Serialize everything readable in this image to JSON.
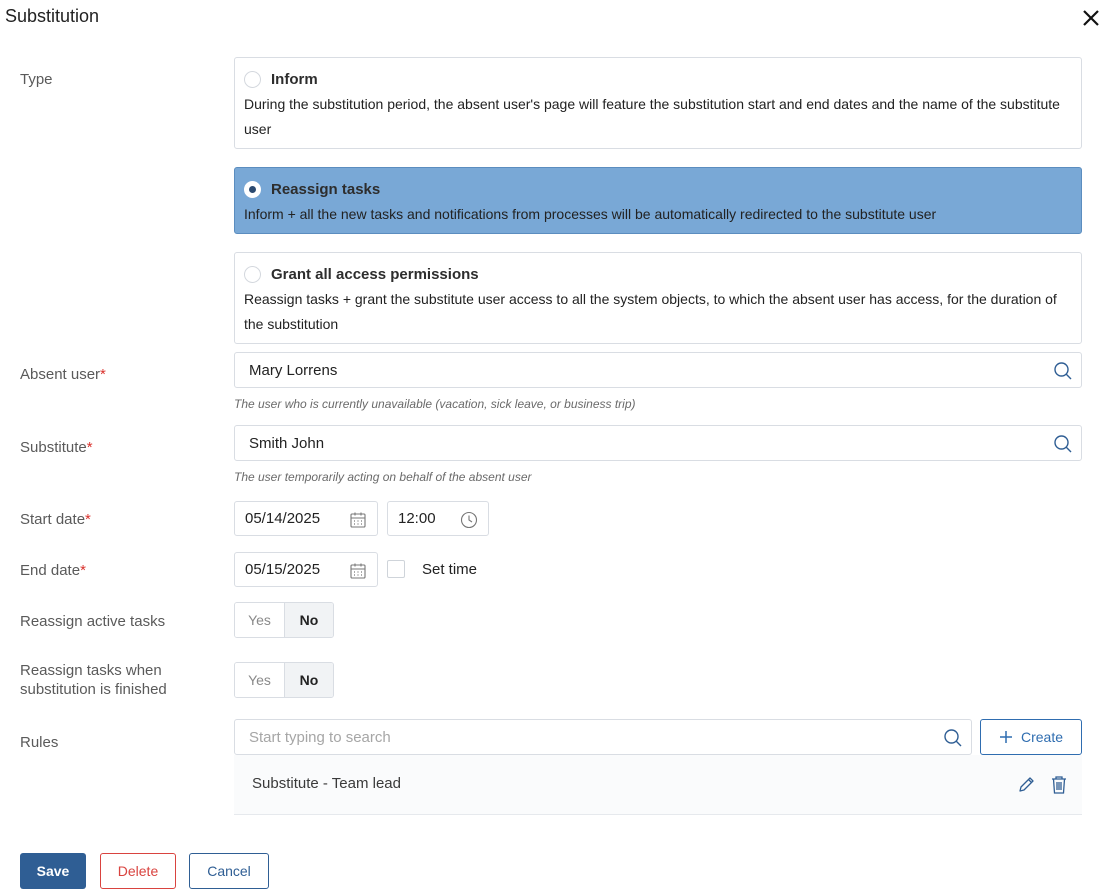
{
  "dialog": {
    "title": "Substitution"
  },
  "type_section": {
    "label": "Type",
    "options": [
      {
        "title": "Inform",
        "description": "During the substitution period, the absent user's page will feature the substitution start and end dates and the name of the substitute user",
        "selected": false
      },
      {
        "title": "Reassign tasks",
        "description": "Inform + all the new tasks and notifications from processes will be automatically redirected to the substitute user",
        "selected": true
      },
      {
        "title": "Grant all access permissions",
        "description": "Reassign tasks + grant the substitute user access to all the system objects, to which the absent user has access, for the duration of the substitution",
        "selected": false
      }
    ]
  },
  "absent_user": {
    "label": "Absent user",
    "value": "Mary Lorrens",
    "hint": "The user who is currently unavailable (vacation, sick leave, or business trip)"
  },
  "substitute": {
    "label": "Substitute",
    "value": "Smith John",
    "hint": "The user temporarily acting on behalf of the absent user"
  },
  "start_date": {
    "label": "Start date",
    "date": "05/14/2025",
    "time": "12:00"
  },
  "end_date": {
    "label": "End date",
    "date": "05/15/2025",
    "set_time_label": "Set time"
  },
  "reassign_active": {
    "label": "Reassign active tasks",
    "yes": "Yes",
    "no": "No",
    "selected": "No"
  },
  "reassign_finished": {
    "label": "Reassign tasks when substitution is finished",
    "label_line1": "Reassign tasks when",
    "label_line2": "substitution is finished",
    "yes": "Yes",
    "no": "No",
    "selected": "No"
  },
  "rules": {
    "label": "Rules",
    "placeholder": "Start typing to search",
    "create_label": "Create",
    "items": [
      "Substitute - Team lead"
    ]
  },
  "footer": {
    "save_label": "Save",
    "delete_label": "Delete",
    "cancel_label": "Cancel"
  },
  "colors": {
    "accent": "#2f5e94",
    "selected_card": "#79a8d6",
    "required": "#d9312c",
    "danger": "#d9433f"
  }
}
